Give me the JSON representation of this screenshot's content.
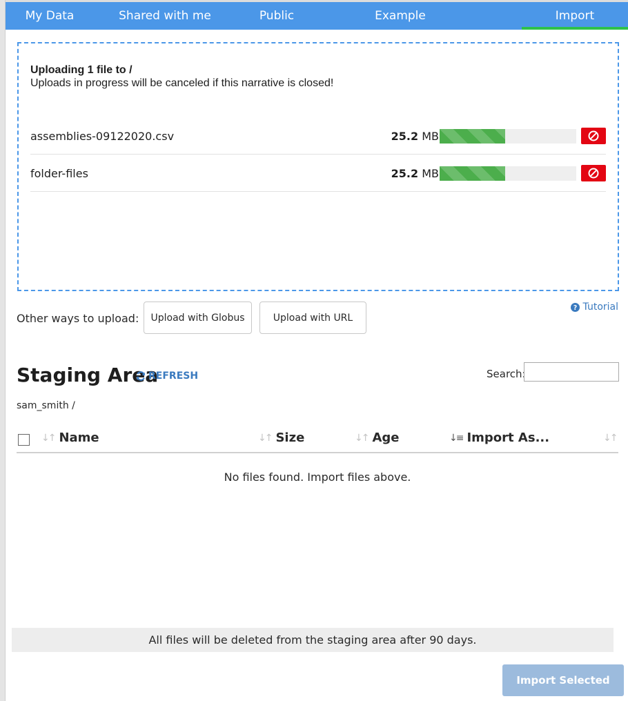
{
  "tabs": [
    {
      "label": "My Data",
      "active": false
    },
    {
      "label": "Shared with me",
      "active": false
    },
    {
      "label": "Public",
      "active": false
    },
    {
      "label": "Example",
      "active": false
    },
    {
      "label": "Import",
      "active": true
    }
  ],
  "upload": {
    "title": "Uploading 1 file to /",
    "note": "Uploads in progress will be canceled if this narrative is closed!",
    "files": [
      {
        "name": "assemblies-09122020.csv",
        "size_value": "25.2",
        "size_unit": "MB",
        "progress_fraction": 0.48
      },
      {
        "name": "folder-files",
        "size_value": "25.2",
        "size_unit": "MB",
        "progress_fraction": 0.48
      }
    ]
  },
  "other_ways": {
    "label": "Other ways to upload:",
    "globus_button": "Upload with Globus",
    "url_button": "Upload with URL",
    "tutorial_link": "Tutorial"
  },
  "staging": {
    "title": "Staging Area",
    "refresh_label": "REFRESH",
    "search_label": "Search:",
    "search_value": "",
    "breadcrumb": "sam_smith /",
    "columns": {
      "name": "Name",
      "size": "Size",
      "age": "Age",
      "import_as": "Import As..."
    },
    "empty_message": "No files found. Import files above.",
    "notice": "All files will be deleted from the staging area after 90 days.",
    "import_button": "Import Selected"
  },
  "colors": {
    "tab_bar": "#4b97e8",
    "active_tab_indicator": "#2ec24a",
    "progress_fill": "#4cae4c",
    "cancel_button": "#e30613",
    "link": "#3a7abf",
    "import_button_disabled": "#9cbbdd"
  },
  "icons": {
    "cancel": "ban-icon",
    "tutorial": "question-circle-icon",
    "refresh": "refresh-icon",
    "sort": "sort-icon"
  }
}
